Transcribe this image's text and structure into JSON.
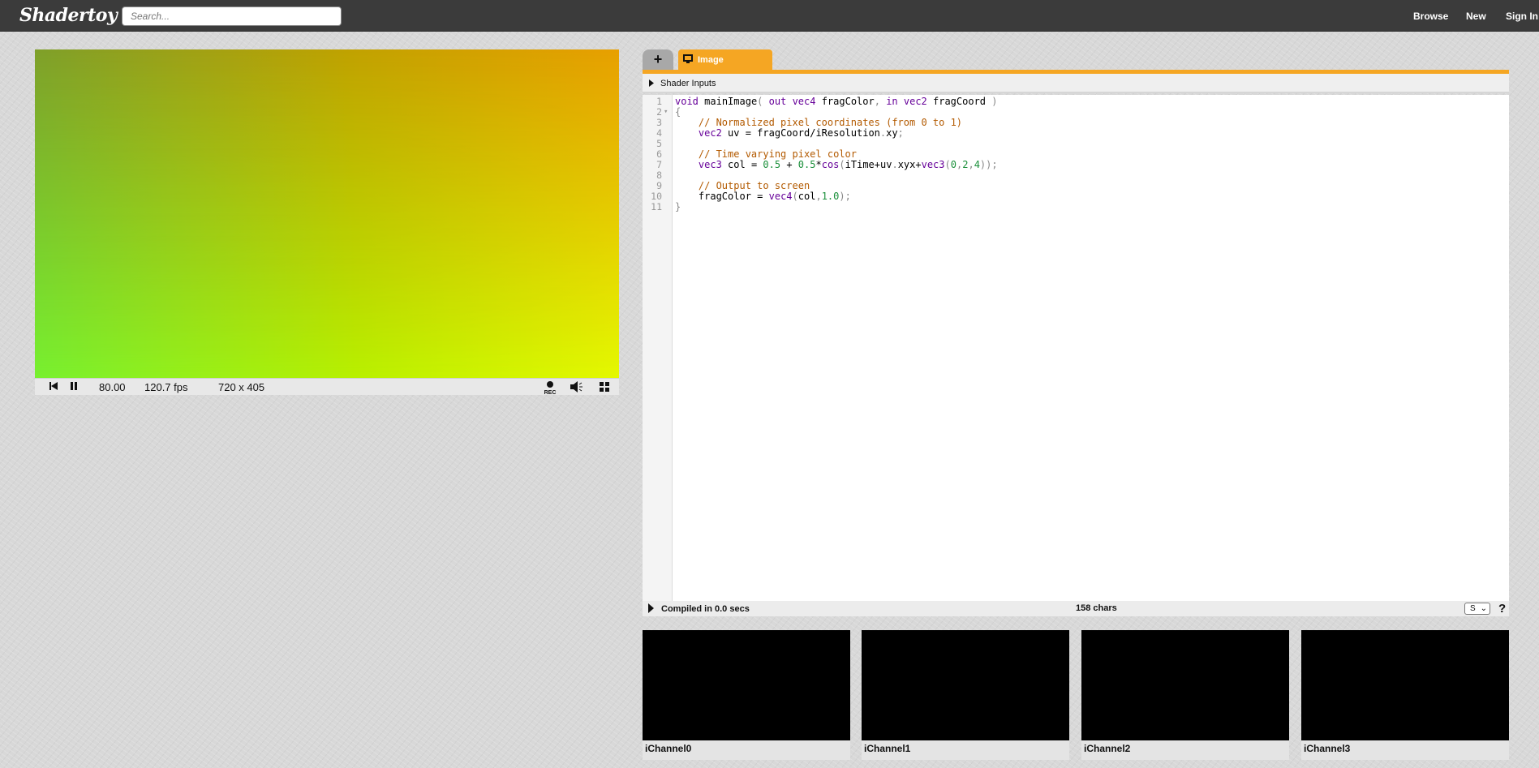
{
  "topbar": {
    "logo": "Shadertoy",
    "search_placeholder": "Search...",
    "nav": [
      "Browse",
      "New",
      "Sign In"
    ]
  },
  "player": {
    "time": "80.00",
    "fps": "120.7 fps",
    "resolution": "720 x 405",
    "icons": [
      "rewind-icon",
      "pause-icon",
      "record-icon",
      "volume-icon",
      "fullscreen-icon"
    ],
    "rec_label": "REC",
    "colors": {
      "top_left": "#7fa02a",
      "top_right": "#e8a000",
      "bottom_left": "#77f030",
      "bottom_right": "#e4f800"
    }
  },
  "editor": {
    "add_tab_label": "+",
    "tab_label": "Image",
    "shader_inputs_label": "Shader Inputs",
    "accent": "#f5a623",
    "code_lines": [
      {
        "n": "1",
        "fold": "",
        "html": "<span class=\"kw\">void</span> <span class=\"fn\">mainImage</span><span class=\"pu\">(</span> <span class=\"kw\">out</span> <span class=\"ty\">vec4</span> fragColor<span class=\"pu\">,</span> <span class=\"kw\">in</span> <span class=\"ty\">vec2</span> fragCoord <span class=\"pu\">)</span>"
      },
      {
        "n": "2",
        "fold": "▾",
        "html": "<span class=\"pu\">{</span>"
      },
      {
        "n": "3",
        "fold": "",
        "html": "    <span class=\"cm\">// Normalized pixel coordinates (from 0 to 1)</span>"
      },
      {
        "n": "4",
        "fold": "",
        "html": "    <span class=\"ty\">vec2</span> uv <span class=\"op\">=</span> fragCoord<span class=\"op\">/</span>iResolution<span class=\"pu\">.</span>xy<span class=\"pu\">;</span>"
      },
      {
        "n": "5",
        "fold": "",
        "html": ""
      },
      {
        "n": "6",
        "fold": "",
        "html": "    <span class=\"cm\">// Time varying pixel color</span>"
      },
      {
        "n": "7",
        "fold": "",
        "html": "    <span class=\"ty\">vec3</span> col <span class=\"op\">=</span> <span class=\"num\">0.5</span> <span class=\"op\">+</span> <span class=\"num\">0.5</span><span class=\"op\">*</span><span class=\"kw\">cos</span><span class=\"pu\">(</span>iTime<span class=\"op\">+</span>uv<span class=\"pu\">.</span>xyx<span class=\"op\">+</span><span class=\"ty\">vec3</span><span class=\"pu\">(</span><span class=\"num\">0</span><span class=\"pu\">,</span><span class=\"num\">2</span><span class=\"pu\">,</span><span class=\"num\">4</span><span class=\"pu\">));</span>"
      },
      {
        "n": "8",
        "fold": "",
        "html": ""
      },
      {
        "n": "9",
        "fold": "",
        "html": "    <span class=\"cm\">// Output to screen</span>"
      },
      {
        "n": "10",
        "fold": "",
        "html": "    fragColor <span class=\"op\">=</span> <span class=\"ty\">vec4</span><span class=\"pu\">(</span>col<span class=\"pu\">,</span><span class=\"num\">1.0</span><span class=\"pu\">);</span>"
      },
      {
        "n": "11",
        "fold": "",
        "html": "<span class=\"pu\">}</span>"
      }
    ],
    "status": {
      "compiled": "Compiled in 0.0 secs",
      "chars": "158 chars",
      "size_select": "S",
      "help": "?"
    }
  },
  "channels": [
    "iChannel0",
    "iChannel1",
    "iChannel2",
    "iChannel3"
  ]
}
